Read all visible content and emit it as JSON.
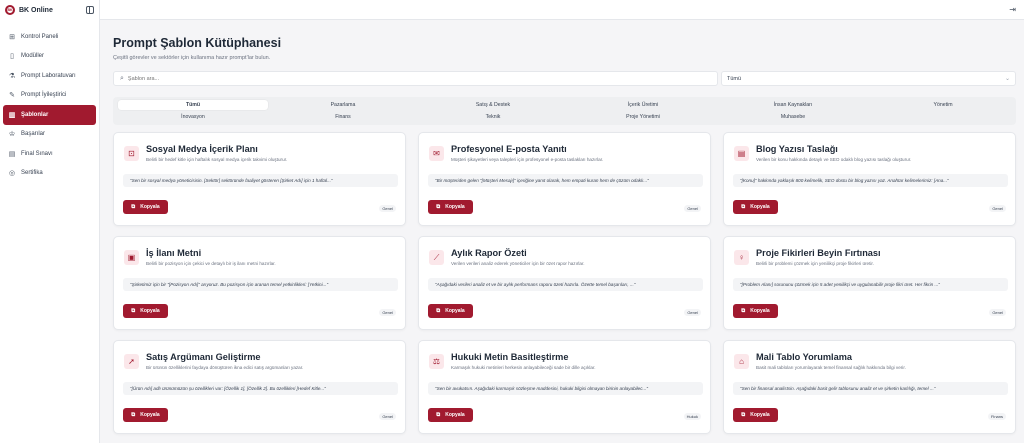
{
  "brand": {
    "name": "BK Online",
    "logo_text": "BK"
  },
  "sidebar": {
    "items": [
      {
        "label": "Kontrol Paneli",
        "icon": "⊞",
        "active": false
      },
      {
        "label": "Modüller",
        "icon": "▯",
        "active": false
      },
      {
        "label": "Prompt Laboratuvarı",
        "icon": "⚗",
        "active": false
      },
      {
        "label": "Prompt İyileştirici",
        "icon": "✎",
        "active": false
      },
      {
        "label": "Şablonlar",
        "icon": "▥",
        "active": true
      },
      {
        "label": "Başarılar",
        "icon": "♔",
        "active": false
      },
      {
        "label": "Final Sınavı",
        "icon": "▤",
        "active": false
      },
      {
        "label": "Sertifika",
        "icon": "◎",
        "active": false
      }
    ]
  },
  "page": {
    "title": "Prompt Şablon Kütüphanesi",
    "subtitle": "Çeşitli görevler ve sektörler için kullanıma hazır prompt'lar bulun."
  },
  "search": {
    "placeholder": "Şablon ara..."
  },
  "filter": {
    "selected": "Tümü"
  },
  "tabs": [
    "Tümü",
    "Pazarlama",
    "Satış & Destek",
    "İçerik Üretimi",
    "İnsan Kaynakları",
    "Yönetim",
    "İnovasyon",
    "Finans",
    "Teknik",
    "Proje Yönetimi",
    "Muhasebe"
  ],
  "cards": [
    {
      "icon": "⊡",
      "title": "Sosyal Medya İçerik Planı",
      "desc": "Belirli bir hedef kitle için haftalık sosyal medya içerik takvimi oluşturur.",
      "prompt": "\"Sen bir sosyal medya yöneticisisin. [Sektör] sektöründe faaliyet gösteren [Şirket Adı] için 1 haftal...\"",
      "button": "Kopyala",
      "badge": "Genel"
    },
    {
      "icon": "✉",
      "title": "Profesyonel E-posta Yanıtı",
      "desc": "Müşteri şikayetleri veya talepleri için profesyonel e-posta taslakları hazırlar.",
      "prompt": "\"Bir müşteriden gelen \"[Müşteri Mesajı]\" içeriğine yanıt olarak, hem empati kuran hem de çözüm odaklı...\"",
      "button": "Kopyala",
      "badge": "Genel"
    },
    {
      "icon": "▤",
      "title": "Blog Yazısı Taslağı",
      "desc": "Verilen bir konu hakkında detaylı ve SEO odaklı blog yazısı taslağı oluşturur.",
      "prompt": "\"[Konu]\" hakkında yaklaşık 800 kelimelik, SEO dostu bir blog yazısı yaz. Anahtar kelimelerimiz: [Ana...\"",
      "button": "Kopyala",
      "badge": "Genel"
    },
    {
      "icon": "▣",
      "title": "İş İlanı Metni",
      "desc": "Belirli bir pozisyon için çekici ve detaylı bir iş ilanı metni hazırlar.",
      "prompt": "\"Şirketimiz için bir \"[Pozisyon Adı]\" arıyoruz. Bu pozisyon için aranan temel yetkinlikleri: [Yetkini...\"",
      "button": "Kopyala",
      "badge": "Genel"
    },
    {
      "icon": "⟋",
      "title": "Aylık Rapor Özeti",
      "desc": "Verilen verileri analiz ederek yöneticiler için bir özet rapor hazırlar.",
      "prompt": "\"Aşağıdaki verileri analiz et ve bir aylık performans raporu özeti hazırla. Özette temel başarıları, ...\"",
      "button": "Kopyala",
      "badge": "Genel"
    },
    {
      "icon": "♀",
      "title": "Proje Fikirleri Beyin Fırtınası",
      "desc": "Belirli bir problemi çözmek için yenilikçi proje fikirleri üretir.",
      "prompt": "\"[Problem Alanı] sorununu çözmek için 5 adet yenilikçi ve uygulanabilir proje fikri üret. Her fikrin ...\"",
      "button": "Kopyala",
      "badge": "Genel"
    },
    {
      "icon": "➚",
      "title": "Satış Argümanı Geliştirme",
      "desc": "Bir ürünün özelliklerini faydaya dönüştüren ikna edici satış argümanları yazar.",
      "prompt": "\"[Ürün Adı] adlı ürünümüzün şu özellikleri var: [Özellik 1], [Özellik 2]. Bu özellikleri [Hedef Kitle...\"",
      "button": "Kopyala",
      "badge": "Genel"
    },
    {
      "icon": "⚖",
      "title": "Hukuki Metin Basitleştirme",
      "desc": "Karmaşık hukuki metinleri herkesin anlayabileceği sade bir dille açıklar.",
      "prompt": "\"Sen bir avukatsın. Aşağıdaki karmaşık sözleşme maddesini, hukuki bilgisi olmayan birinin anlayabilec...\"",
      "button": "Kopyala",
      "badge": "Hukuk"
    },
    {
      "icon": "⌂",
      "title": "Mali Tablo Yorumlama",
      "desc": "Basit mali tabloları yorumlayarak temel finansal sağlık hakkında bilgi verir.",
      "prompt": "\"Sen bir finansal analistsin. Aşağıdaki basit gelir tablosunu analiz et ve şirketin karlılığı, temel ...\"",
      "button": "Kopyala",
      "badge": "Finans"
    }
  ]
}
